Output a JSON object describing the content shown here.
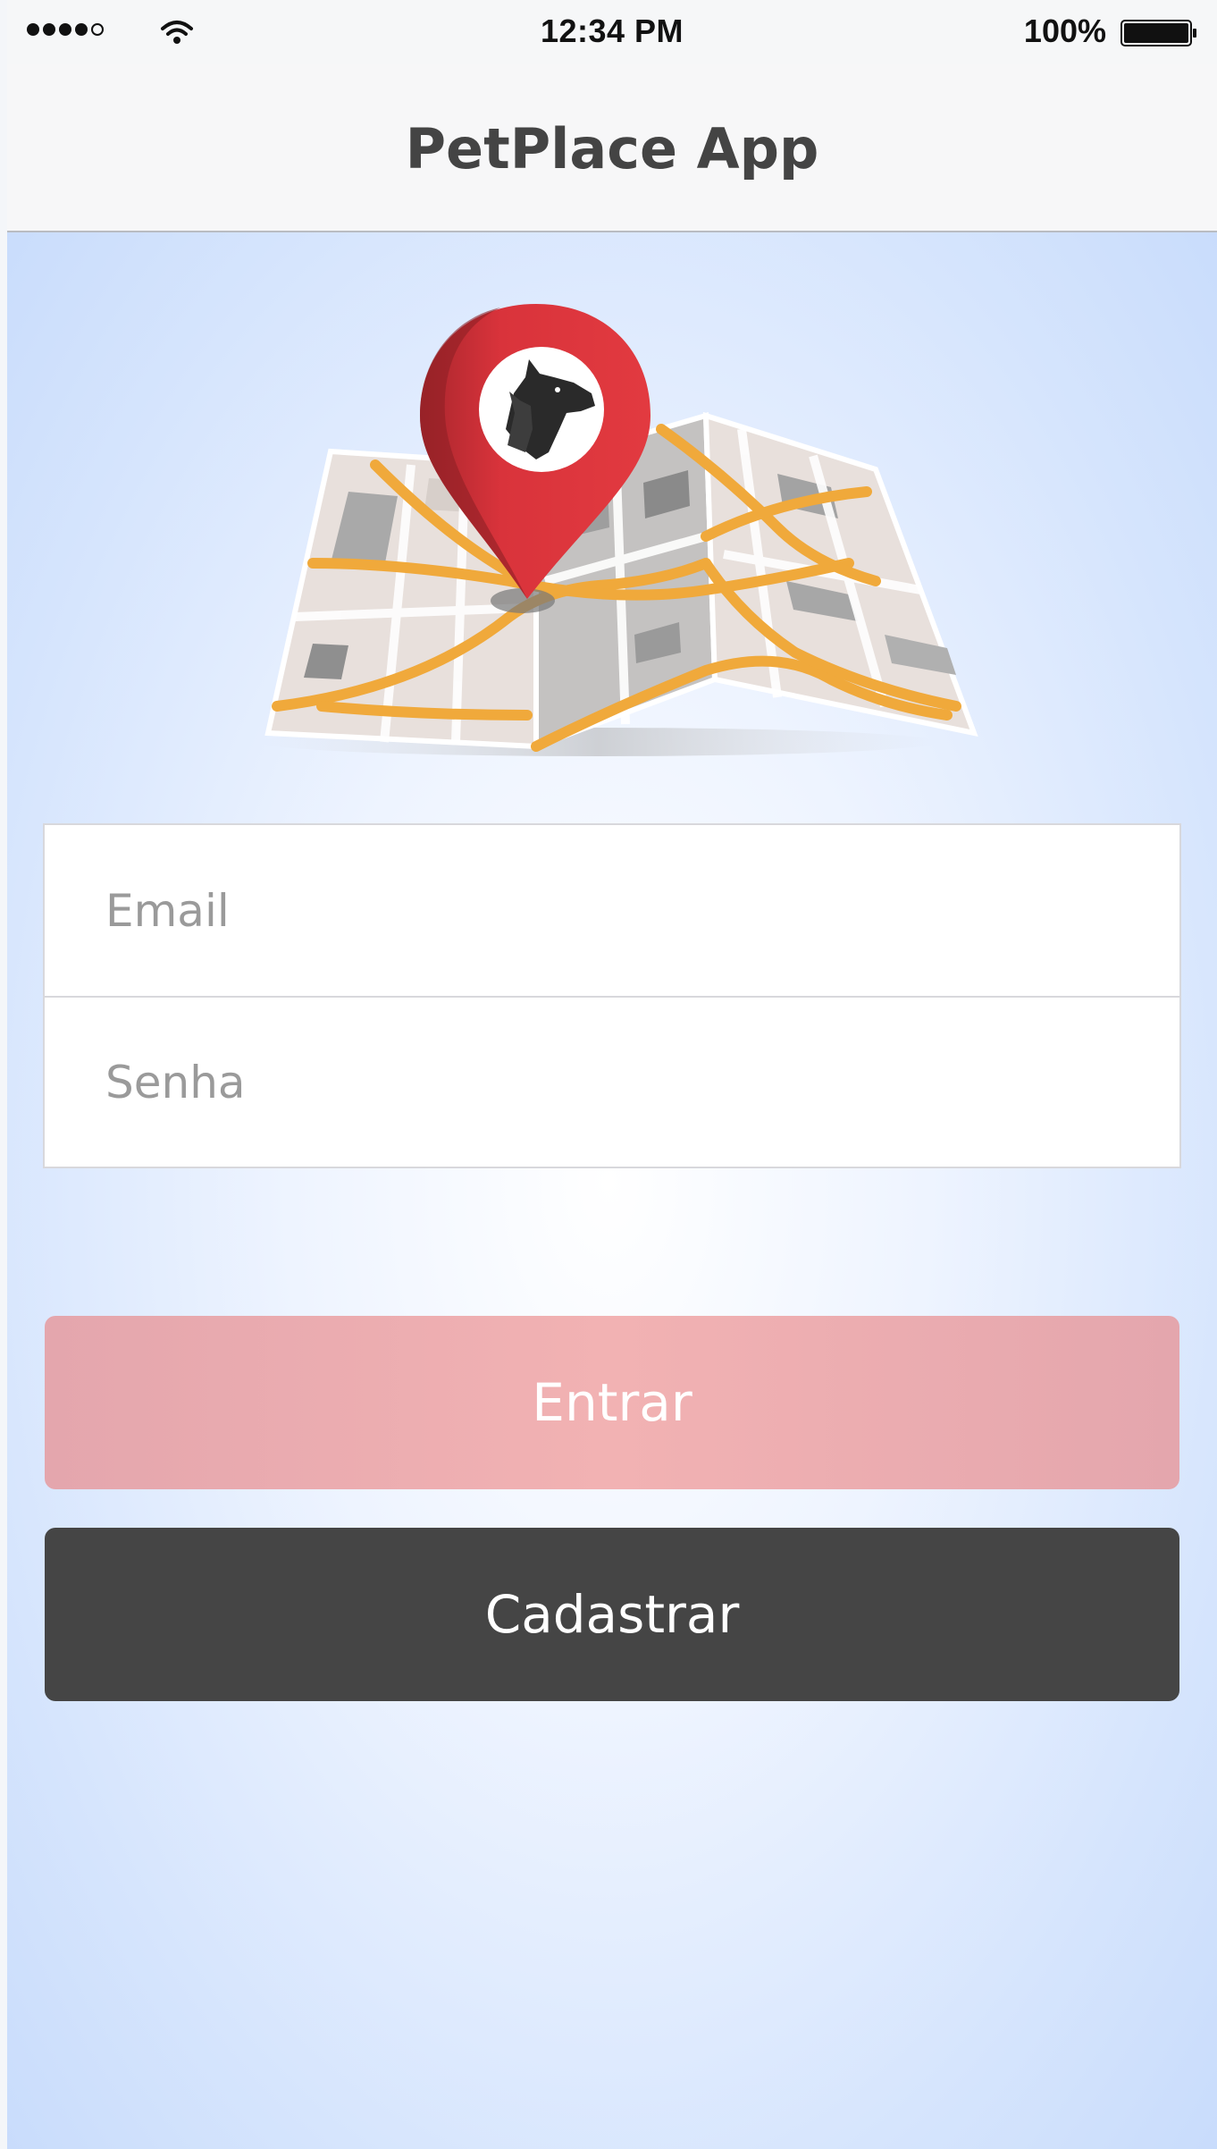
{
  "status_bar": {
    "time": "12:34 PM",
    "battery_percent": "100%",
    "signal_bars": 4,
    "signal_bars_total": 5,
    "icons": [
      "signal-icon",
      "wifi-icon",
      "battery-icon"
    ]
  },
  "nav": {
    "title": "PetPlace App"
  },
  "logo": {
    "icon": "map-pin-pet-icon",
    "colors": {
      "pin": "#d9333b",
      "road": "#f0a93b",
      "map_light": "#e9e1dc",
      "map_gray": "#b9b9b9"
    }
  },
  "form": {
    "email_placeholder": "Email",
    "email_value": "",
    "password_placeholder": "Senha",
    "password_value": ""
  },
  "buttons": {
    "login_label": "Entrar",
    "register_label": "Cadastrar"
  },
  "colors": {
    "login_button": "#efb1b3",
    "register_button": "#454545",
    "background": "#d6e5fd"
  }
}
